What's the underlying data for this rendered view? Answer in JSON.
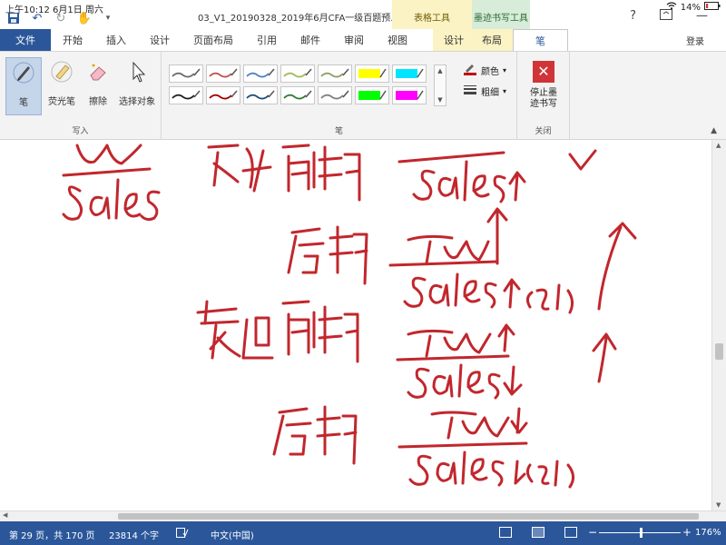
{
  "ipad": {
    "time": "上午10:12",
    "date": "6月1日 周六",
    "battery": "14%"
  },
  "window": {
    "title": "03_V1_20190328_2019年6月CFA一级百题预...",
    "context_table": "表格工具",
    "context_ink": "墨迹书写工具",
    "login": "登录"
  },
  "tabs": [
    {
      "label": "文件"
    },
    {
      "label": "开始"
    },
    {
      "label": "插入"
    },
    {
      "label": "设计"
    },
    {
      "label": "页面布局"
    },
    {
      "label": "引用"
    },
    {
      "label": "邮件"
    },
    {
      "label": "审阅"
    },
    {
      "label": "视图"
    },
    {
      "label": "设计"
    },
    {
      "label": "布局"
    },
    {
      "label": "笔"
    }
  ],
  "ribbon": {
    "write_group": {
      "label": "写入",
      "buttons": [
        {
          "label": "笔",
          "icon": "pen-icon"
        },
        {
          "label": "荧光笔",
          "icon": "highlighter-icon"
        },
        {
          "label": "擦除",
          "icon": "eraser-icon"
        },
        {
          "label": "选择对象",
          "icon": "select-arrow-icon"
        }
      ]
    },
    "pens_group": {
      "label": "笔",
      "pens": [
        {
          "color": "#6b6b6b"
        },
        {
          "color": "#c0504d"
        },
        {
          "color": "#4f81bd"
        },
        {
          "color": "#9bbb59"
        },
        {
          "color": "#8aa05f"
        },
        {
          "color": "#ffff00",
          "marker": true
        },
        {
          "color": "#00e5ff",
          "marker": true
        },
        {
          "color": "#222222"
        },
        {
          "color": "#a00000"
        },
        {
          "color": "#1f4e79"
        },
        {
          "color": "#2e7d32"
        },
        {
          "color": "#7f7f7f"
        },
        {
          "color": "#00ff00",
          "marker": true
        },
        {
          "color": "#ff00ff",
          "marker": true
        }
      ],
      "color_label": "颜色",
      "weight_label": "粗细"
    },
    "close_group": {
      "label": "关闭",
      "stop_label": "停止墨迹书写"
    }
  },
  "status_bar": {
    "page": "第 29 页，共 170 页",
    "words": "23814 个字",
    "language": "中文(中国)",
    "zoom": "176%"
  },
  "colors": {
    "brand": "#2b579a",
    "ink": "#c1272d"
  }
}
